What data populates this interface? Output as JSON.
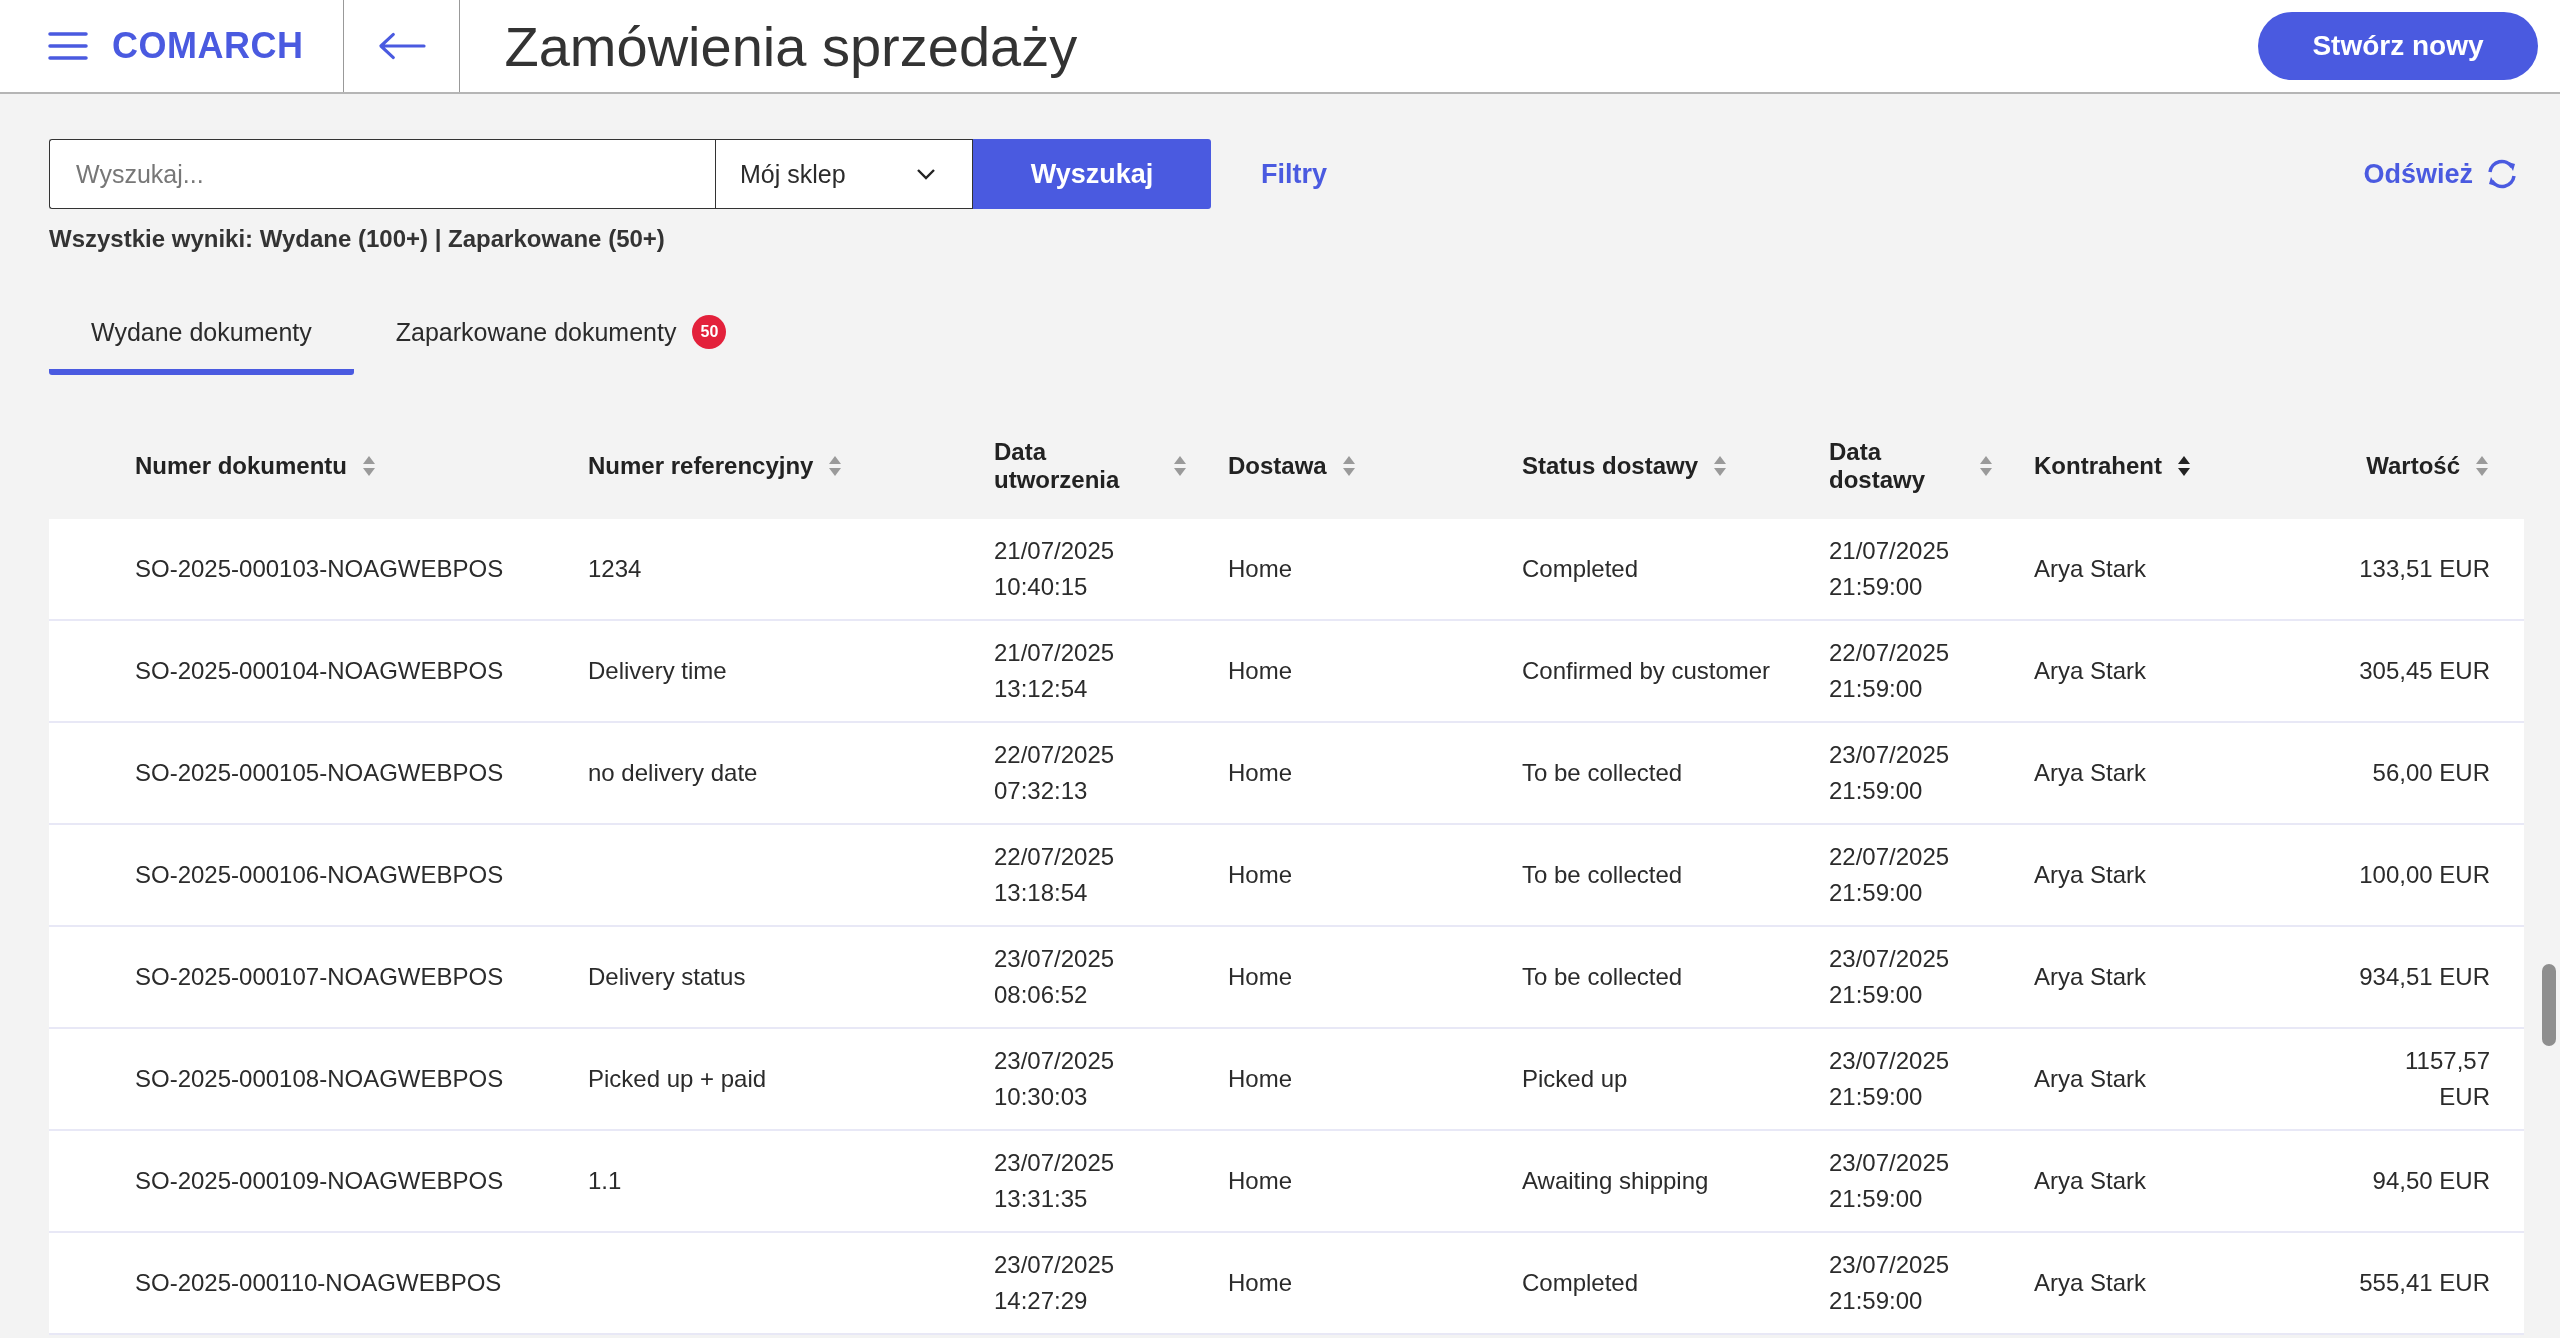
{
  "header": {
    "logo": "COMARCH",
    "title": "Zamówienia sprzedaży",
    "create_button": "Stwórz nowy"
  },
  "search": {
    "placeholder": "Wyszukaj...",
    "store": "Mój sklep",
    "button": "Wyszukaj",
    "filters": "Filtry",
    "refresh": "Odśwież"
  },
  "summary": "Wszystkie wyniki: Wydane (100+) | Zaparkowane (50+)",
  "tabs": [
    {
      "label": "Wydane dokumenty",
      "selected": true
    },
    {
      "label": "Zaparkowane dokumenty",
      "selected": false,
      "badge": "50"
    }
  ],
  "table": {
    "columns": [
      {
        "label": "Numer dokumentu",
        "sorted": false
      },
      {
        "label": "Numer referencyjny",
        "sorted": false
      },
      {
        "label": "Data utworzenia",
        "sorted": false
      },
      {
        "label": "Dostawa",
        "sorted": false
      },
      {
        "label": "Status dostawy",
        "sorted": false
      },
      {
        "label": "Data dostawy",
        "sorted": false
      },
      {
        "label": "Kontrahent",
        "sorted": true
      },
      {
        "label": "Wartość",
        "sorted": false
      }
    ],
    "rows": [
      [
        "SO-2025-000103-NOAGWEBPOS",
        "1234",
        "21/07/2025 10:40:15",
        "Home",
        "Completed",
        "21/07/2025 21:59:00",
        "Arya Stark",
        "133,51 EUR"
      ],
      [
        "SO-2025-000104-NOAGWEBPOS",
        "Delivery time",
        "21/07/2025 13:12:54",
        "Home",
        "Confirmed by customer",
        "22/07/2025 21:59:00",
        "Arya Stark",
        "305,45 EUR"
      ],
      [
        "SO-2025-000105-NOAGWEBPOS",
        "no delivery date",
        "22/07/2025 07:32:13",
        "Home",
        "To be collected",
        "23/07/2025 21:59:00",
        "Arya Stark",
        "56,00 EUR"
      ],
      [
        "SO-2025-000106-NOAGWEBPOS",
        "",
        "22/07/2025 13:18:54",
        "Home",
        "To be collected",
        "22/07/2025 21:59:00",
        "Arya Stark",
        "100,00 EUR"
      ],
      [
        "SO-2025-000107-NOAGWEBPOS",
        "Delivery status",
        "23/07/2025 08:06:52",
        "Home",
        "To be collected",
        "23/07/2025 21:59:00",
        "Arya Stark",
        "934,51 EUR"
      ],
      [
        "SO-2025-000108-NOAGWEBPOS",
        "Picked up + paid",
        "23/07/2025 10:30:03",
        "Home",
        "Picked up",
        "23/07/2025 21:59:00",
        "Arya Stark",
        "1157,57 EUR"
      ],
      [
        "SO-2025-000109-NOAGWEBPOS",
        "1.1",
        "23/07/2025 13:31:35",
        "Home",
        "Awaiting shipping",
        "23/07/2025 21:59:00",
        "Arya Stark",
        "94,50 EUR"
      ],
      [
        "SO-2025-000110-NOAGWEBPOS",
        "",
        "23/07/2025 14:27:29",
        "Home",
        "Completed",
        "23/07/2025 21:59:00",
        "Arya Stark",
        "555,41 EUR"
      ]
    ]
  }
}
